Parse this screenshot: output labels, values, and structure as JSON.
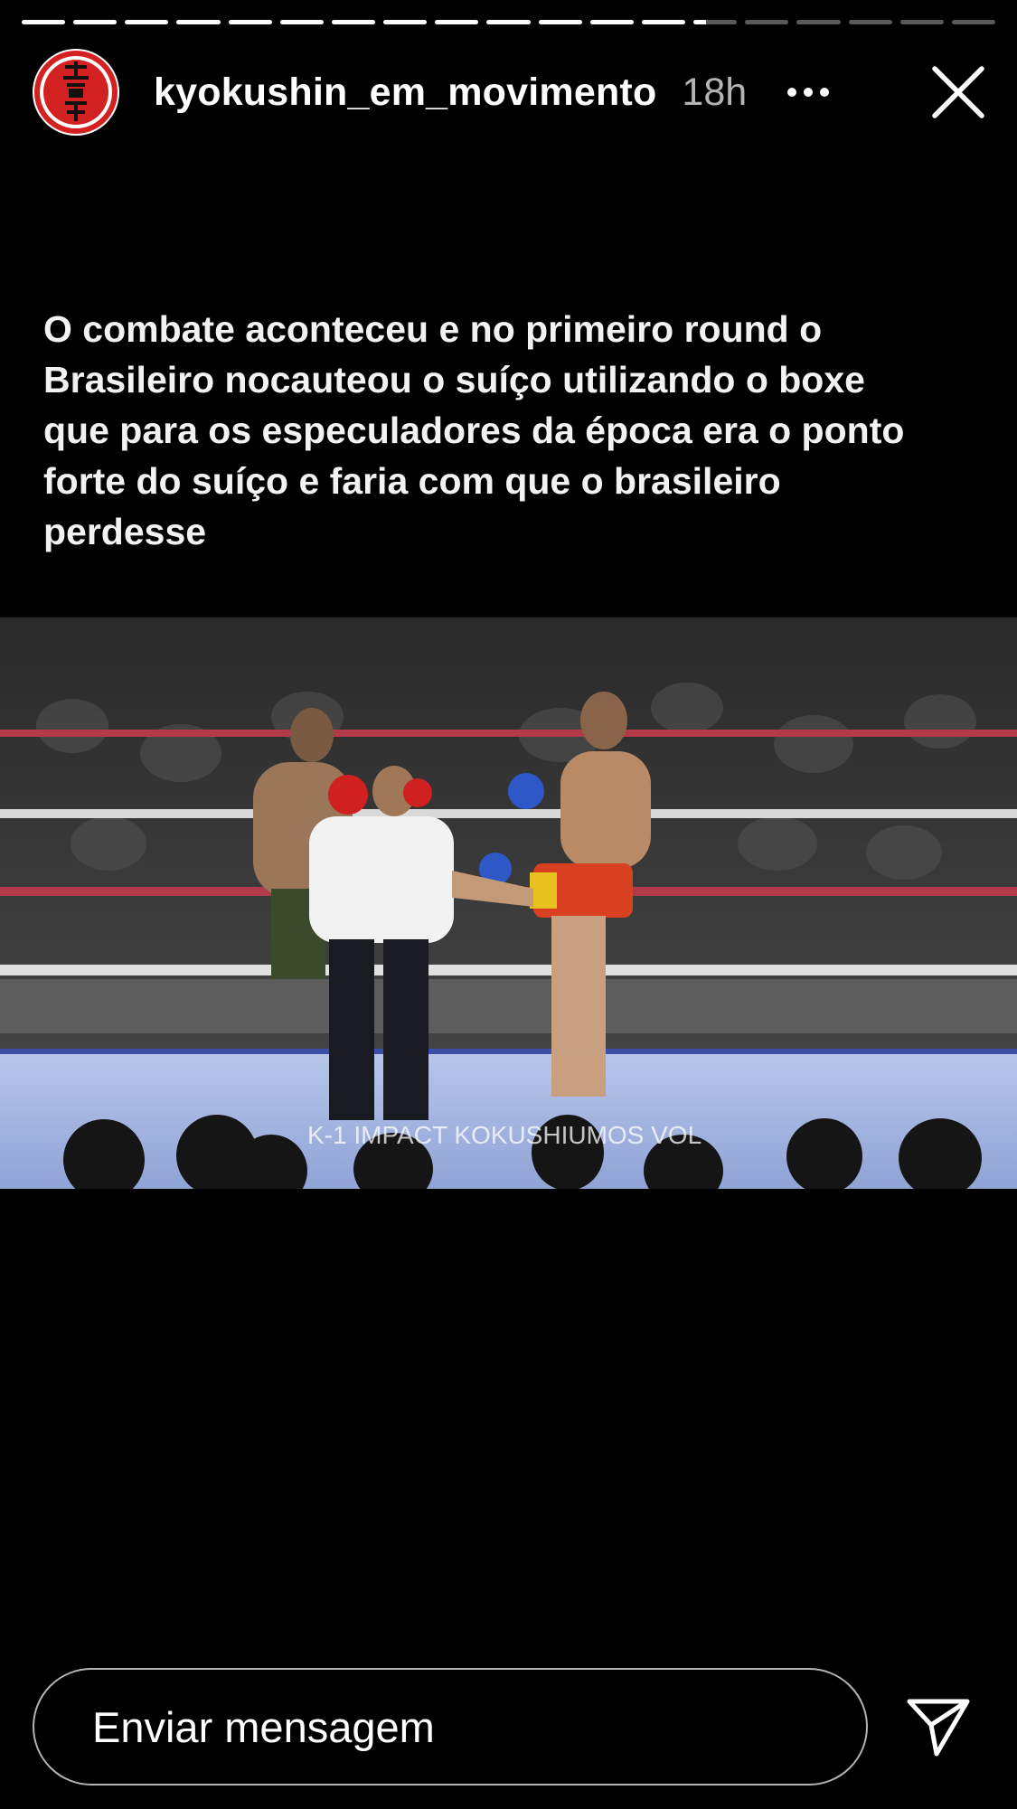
{
  "story": {
    "segments_total": 19,
    "segments_complete": 13,
    "current_segment_progress": 0.3
  },
  "header": {
    "username": "kyokushin_em_movimento",
    "time": "18h",
    "avatar_icon": "kyokushin-kanji-logo-icon",
    "more_icon": "more-horizontal-icon",
    "close_icon": "close-icon"
  },
  "caption": {
    "text": "O combate aconteceu e no primeiro round o Brasileiro nocauteou o suíço utilizando o boxe que para os especuladores da época era o ponto forte do suíço e faria com que o brasileiro perdesse"
  },
  "media": {
    "description_icon": "fight-video-frame",
    "overlay_text": "K-1 IMPACT KOKUSHIUMOS VOL"
  },
  "footer": {
    "message_placeholder": "Enviar mensagem",
    "send_icon": "send-paper-plane-icon"
  },
  "colors": {
    "background": "#000000",
    "logo_red": "#d32020",
    "ring_rope_red": "#c02a3a",
    "ring_canvas": "#9fb3e0"
  }
}
